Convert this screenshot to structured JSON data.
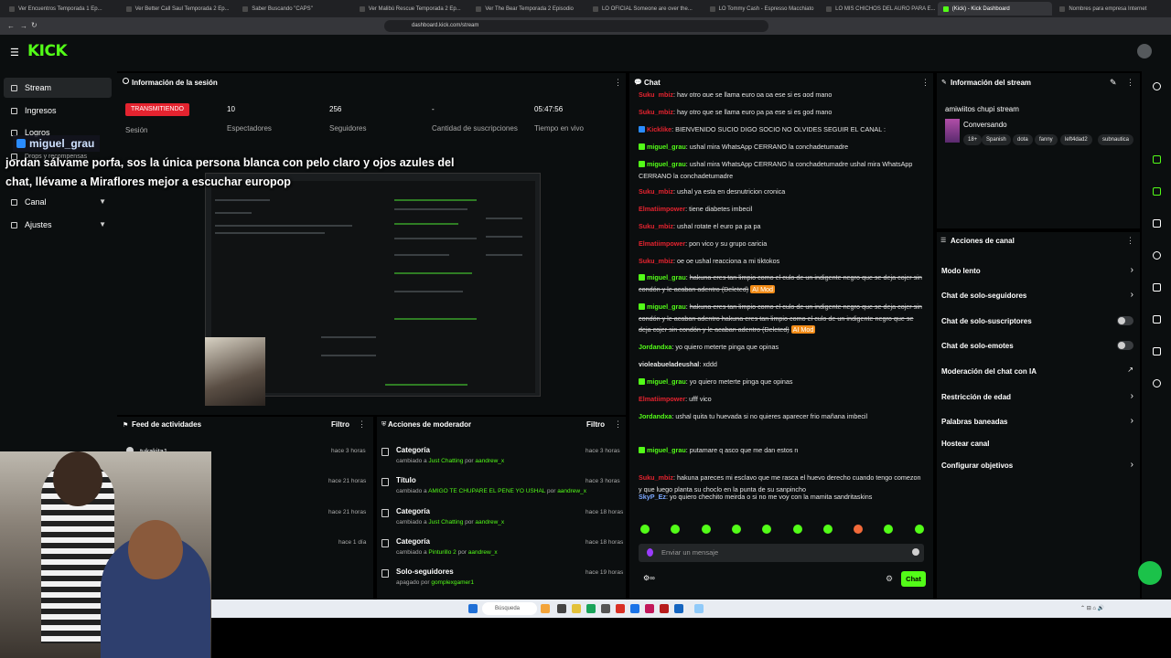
{
  "browser": {
    "tabs": [
      "Ver Encuentros Temporada 1 Ep...",
      "Ver Better Call Saul Temporada 2 Ep...",
      "Saber Buscando \"CAPS\"",
      "Ver Malibú Rescue Temporada 2 Ep...",
      "Ver The Bear Temporada 2 Episodio",
      "LO OFICIAL Someone are over the...",
      "LO Tommy Cash - Espresso Macchiato",
      "LO MIS CHICHOS DEL AURO PARA E...",
      "(Kick) - Kick Dashboard",
      "Nombres para empresa Internet"
    ],
    "active_tab": 8,
    "url": "dashboard.kick.com/stream"
  },
  "header": {
    "logo": "KICK"
  },
  "sidebar": {
    "items": [
      {
        "label": "Stream"
      },
      {
        "label": "Ingresos"
      },
      {
        "label": "Logros"
      },
      {
        "label": "Drops y recompensas"
      },
      {
        "label": "Canal"
      },
      {
        "label": "Ajustes"
      }
    ]
  },
  "session": {
    "title": "Información de la sesión",
    "badge": "TRANSMITIENDO",
    "badge_label": "Sesión",
    "stats": [
      {
        "value": "10",
        "label": "Espectadores"
      },
      {
        "value": "256",
        "label": "Seguidores"
      },
      {
        "value": "-",
        "label": "Cantidad de suscripciones"
      },
      {
        "value": "05:47:56",
        "label": "Tiempo en vivo"
      }
    ]
  },
  "overlay": {
    "username": "miguel_grau",
    "caption": "jordan sálvame porfa, sos la única persona blanca con pelo claro y ojos azules del chat, llévame a Miraflores mejor a escuchar europop"
  },
  "feed": {
    "title": "Feed de actividades",
    "filter": "Filtro",
    "items": [
      {
        "name": "tukakita1",
        "time": "hace 3 horas"
      },
      {
        "name": "",
        "time": "hace 21 horas"
      },
      {
        "name": "",
        "time": "hace 21 horas"
      },
      {
        "name": "",
        "time": "hace 1 día"
      }
    ]
  },
  "mod_actions": {
    "title": "Acciones de moderador",
    "filter": "Filtro",
    "items": [
      {
        "title": "Categoría",
        "pre": "cambiado a ",
        "value": "Just Chatting",
        "mid": " por ",
        "user": "aandrew_x",
        "time": "hace 3 horas"
      },
      {
        "title": "Título",
        "pre": "cambiado a ",
        "value": "AMIGO TE CHUPARE EL PENE YO USHAL",
        "mid": " por ",
        "user": "aandrew_x",
        "time": "hace 3 horas"
      },
      {
        "title": "Categoría",
        "pre": "cambiado a ",
        "value": "Just Chatting",
        "mid": " por ",
        "user": "aandrew_x",
        "time": "hace 18 horas"
      },
      {
        "title": "Categoría",
        "pre": "cambiado a ",
        "value": "Pinturillo 2",
        "mid": " por ",
        "user": "aandrew_x",
        "time": "hace 18 horas"
      },
      {
        "title": "Solo-seguidores",
        "pre": "apagado ",
        "value": "",
        "mid": "por ",
        "user": "gomplexgamer1",
        "time": "hace 19 horas"
      }
    ]
  },
  "chat": {
    "title": "Chat",
    "input_placeholder": "Enviar un mensaje",
    "send_label": "Chat",
    "messages": [
      {
        "user": "Suku_mbiz",
        "color": "#e4232f",
        "badge": "",
        "text": "hay otro que se llama euro pa pa ese si es god mano",
        "deleted": false,
        "am": false
      },
      {
        "user": "Suku_mbiz",
        "color": "#e4232f",
        "badge": "",
        "text": "hay otro que se llama euro pa pa ese si es god mano",
        "deleted": false,
        "am": false
      },
      {
        "user": "Kicklike",
        "color": "#e4232f",
        "badge": "b",
        "text": "BIENVENIDO SUCIO DIGO SOCIO NO OLVIDES SEGUIR EL CANAL :",
        "deleted": false,
        "am": false
      },
      {
        "user": "miguel_grau",
        "color": "#53fc18",
        "badge": "g",
        "text": "ushal mira WhatsApp CERRANO la conchadetumadre",
        "deleted": false,
        "am": false
      },
      {
        "user": "miguel_grau",
        "color": "#53fc18",
        "badge": "g",
        "text": "ushal mira WhatsApp CERRANO la conchadetumadre ushal mira WhatsApp CERRANO la conchadetumadre",
        "deleted": false,
        "am": false
      },
      {
        "user": "Suku_mbiz",
        "color": "#e4232f",
        "badge": "",
        "text": "ushal ya esta en desnutricion cronica",
        "deleted": false,
        "am": false
      },
      {
        "user": "Elmatiimpower",
        "color": "#e4232f",
        "badge": "",
        "text": "tiene diabetes imbecil",
        "deleted": false,
        "am": false
      },
      {
        "user": "Suku_mbiz",
        "color": "#e4232f",
        "badge": "",
        "text": "ushal rotate el euro pa pa pa",
        "deleted": false,
        "am": false
      },
      {
        "user": "Elmatiimpower",
        "color": "#e4232f",
        "badge": "",
        "text": "pon vico y su grupo caricia",
        "deleted": false,
        "am": false
      },
      {
        "user": "Suku_mbiz",
        "color": "#e4232f",
        "badge": "",
        "text": "oe oe ushal reacciona a mi tiktokos",
        "deleted": false,
        "am": false
      },
      {
        "user": "miguel_grau",
        "color": "#53fc18",
        "badge": "g",
        "text": "hakuna eres tan limpio como el culo de un indigente negro que se deja cojer sin condón y le acaban adentro (Deleted)",
        "deleted": true,
        "am": true
      },
      {
        "user": "miguel_grau",
        "color": "#53fc18",
        "badge": "g",
        "text": "hakuna eres tan limpio como el culo de un indigente negro que se deja cojer sin condón y le acaban adentro hakuna eres tan limpio como el culo de un indigente negro que se deja cojer sin condón y le acaban adentro (Deleted)",
        "deleted": true,
        "am": true
      },
      {
        "user": "Jordandxa",
        "color": "#53fc18",
        "badge": "",
        "text": "yo quiero meterte pinga que opinas",
        "deleted": false,
        "am": false
      },
      {
        "user": "violeabueladeushal",
        "color": "#e6e6e6",
        "badge": "",
        "text": "xddd",
        "deleted": false,
        "am": false
      },
      {
        "user": "miguel_grau",
        "color": "#53fc18",
        "badge": "g",
        "text": "yo quiero meterte pinga que opinas",
        "deleted": false,
        "am": false
      },
      {
        "user": "Elmatiimpower",
        "color": "#e4232f",
        "badge": "",
        "text": "ufff vico",
        "deleted": false,
        "am": false
      },
      {
        "user": "Jordandxa",
        "color": "#53fc18",
        "badge": "",
        "text": "ushal quita tu huevada si no quieres aparecer frio mañana imbecil",
        "deleted": false,
        "am": false
      },
      {
        "user": "miguel_grau",
        "color": "#53fc18",
        "badge": "g",
        "text": "putamare q asco que me dan estos n",
        "deleted": false,
        "am": false
      },
      {
        "user": "Suku_mbiz",
        "color": "#e4232f",
        "badge": "",
        "text": "hakuna pareces mi esclavo que me rasca el huevo derecho cuando tengo comezon y que luego planta su choclo en la punta de su sanpincho",
        "deleted": false,
        "am": false
      },
      {
        "user": "SkyP_Ez",
        "color": "#7aa7ff",
        "badge": "",
        "text": "yo quiero chechito meirda o si no me voy con la mamita sandritaskins",
        "deleted": false,
        "am": false
      },
      {
        "user": "miguel_grau",
        "color": "#53fc18",
        "badge": "g",
        "text": "jordan sálvame porfa, sos la única persona blanca con pelo claro y ojos azules del chat, llévame a Miraflores mejor a escuchar europop",
        "deleted": false,
        "am": false
      }
    ]
  },
  "stream_info": {
    "title": "Información del stream",
    "stream_title": "amiwiitos chupi stream",
    "category": "Conversando",
    "tags": [
      "18+",
      "Spanish",
      "dota",
      "fanny",
      "left4dad2",
      "subnautica"
    ]
  },
  "channel_actions": {
    "title": "Acciones de canal",
    "items": [
      {
        "label": "Modo lento",
        "control": "arrow"
      },
      {
        "label": "Chat de solo-seguidores",
        "control": "arrow"
      },
      {
        "label": "Chat de solo-suscriptores",
        "control": "toggle"
      },
      {
        "label": "Chat de solo-emotes",
        "control": "toggle"
      },
      {
        "label": "Moderación del chat con IA",
        "control": "external"
      },
      {
        "label": "Restricción de edad",
        "control": "arrow"
      },
      {
        "label": "Palabras baneadas",
        "control": "arrow"
      },
      {
        "label": "Hostear canal",
        "control": "none"
      },
      {
        "label": "Configurar objetivos",
        "control": "arrow"
      }
    ]
  },
  "taskbar": {
    "search_label": "Búsqueda"
  },
  "colors": {
    "accent": "#53fc18",
    "live": "#e4232f",
    "panel": "#0b0e0f"
  }
}
